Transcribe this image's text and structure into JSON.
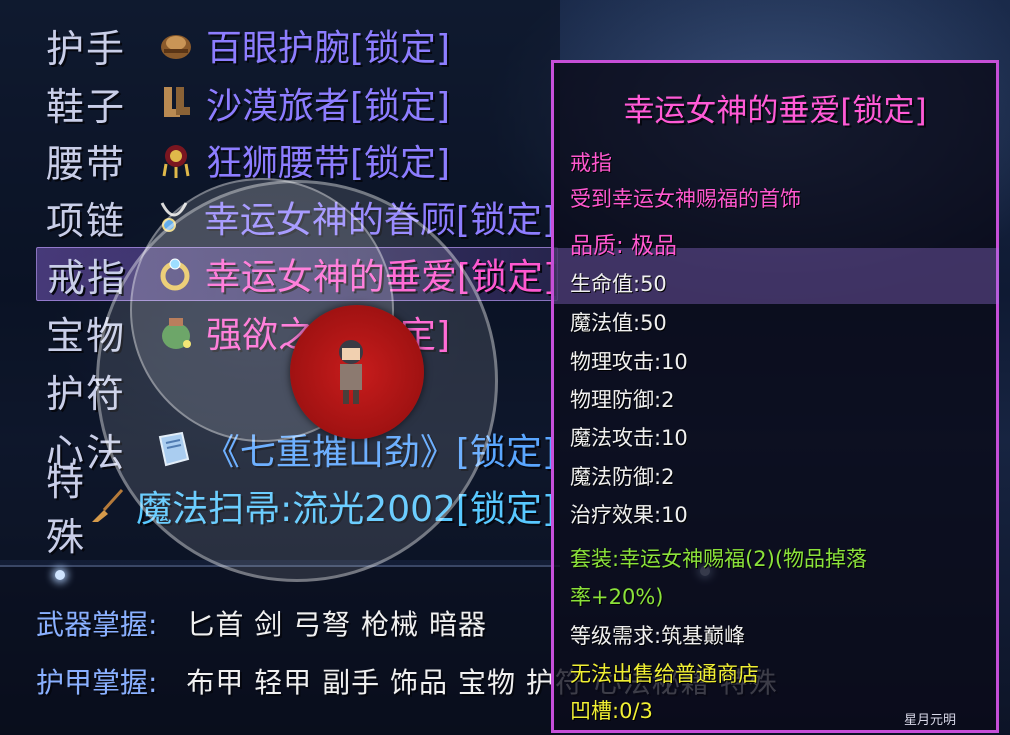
{
  "equipment": [
    {
      "slot": "护手",
      "icon": "bracer-icon",
      "name": "百眼护腕[锁定]",
      "color": "#8d7dff"
    },
    {
      "slot": "鞋子",
      "icon": "boots-icon",
      "name": "沙漠旅者[锁定]",
      "color": "#8d7dff"
    },
    {
      "slot": "腰带",
      "icon": "belt-icon",
      "name": "狂狮腰带[锁定]",
      "color": "#8d7dff"
    },
    {
      "slot": "项链",
      "icon": "necklace-icon",
      "name": "幸运女神的眷顾[锁定]",
      "color": "#8d7dff"
    },
    {
      "slot": "戒指",
      "icon": "ring-icon",
      "name": "幸运女神的垂爱[锁定]",
      "color": "#ff58d0",
      "selected": true
    },
    {
      "slot": "宝物",
      "icon": "treasure-pot-icon",
      "name": "强欲之壶[锁定]",
      "color": "#ff58d0"
    },
    {
      "slot": "护符",
      "icon": "",
      "name": "",
      "color": "#8d7dff"
    },
    {
      "slot": "心法",
      "icon": "book-icon",
      "name": "《七重摧山劲》[锁定]",
      "color": "#5aa6ff"
    },
    {
      "slot": "特殊",
      "icon": "broom-icon",
      "name": "魔法扫帚:流光2002[锁定]",
      "color": "#58c8ff"
    }
  ],
  "skills": {
    "weapon_label": "武器掌握:",
    "weapon_values": "匕首 剑 弓弩 枪械 暗器",
    "armor_label": "护甲掌握:",
    "armor_values": "布甲 轻甲 副手 饰品 宝物 护符 心法秘籍 特殊"
  },
  "tooltip": {
    "title": "幸运女神的垂爱[锁定]",
    "type": "戒指",
    "description": "受到幸运女神赐福的首饰",
    "quality": "品质: 极品",
    "stats": [
      "生命值:50",
      "魔法值:50",
      "物理攻击:10",
      "物理防御:2",
      "魔法攻击:10",
      "魔法防御:2",
      "治疗效果:10"
    ],
    "set_line1": "套装:幸运女神赐福(2)(物品掉落",
    "set_line2": "率+20%)",
    "level_req": "等级需求:筑基巅峰",
    "sell_note": "无法出售给普通商店",
    "sockets": "凹槽:0/3"
  },
  "watermark": "星月元明",
  "colors": {
    "purple_item": "#8d7dff",
    "pink_item": "#ff58d0",
    "blue_item": "#5aa6ff",
    "tooltip_border": "#c64fd8",
    "set_green": "#8be23a",
    "warning_yellow": "#f1f034"
  }
}
